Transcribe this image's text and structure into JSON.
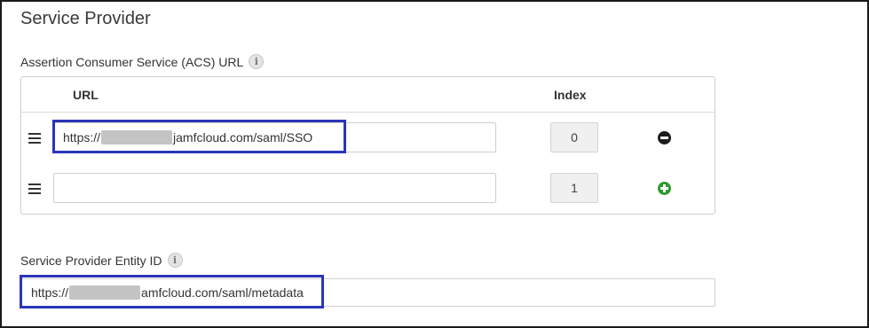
{
  "section": {
    "title": "Service Provider"
  },
  "acs": {
    "label": "Assertion Consumer Service (ACS) URL",
    "info_glyph": "i",
    "headers": {
      "url": "URL",
      "index": "Index"
    },
    "rows": [
      {
        "url_prefix": "https://",
        "url_suffix": "jamfcloud.com/saml/SSO",
        "index": "0",
        "action": "remove",
        "action_icon": "minus-circle-icon"
      },
      {
        "url_prefix": "",
        "url_suffix": "",
        "index": "1",
        "action": "add",
        "action_icon": "plus-circle-icon"
      }
    ]
  },
  "entity": {
    "label": "Service Provider Entity ID",
    "info_glyph": "i",
    "value_prefix": "https://",
    "value_suffix": "amfcloud.com/saml/metadata"
  },
  "colors": {
    "highlight": "#2b35b8",
    "add_button": "#2e9a2e",
    "remove_button": "#1c1c1c"
  }
}
